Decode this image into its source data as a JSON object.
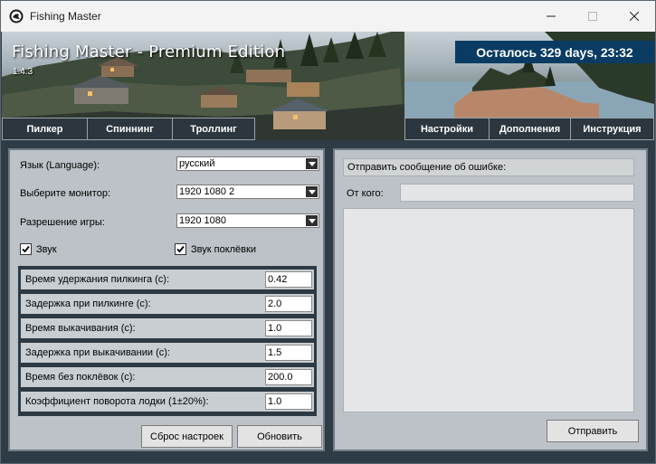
{
  "window": {
    "title": "Fishing Master",
    "icons": {
      "app": "app-logo-icon",
      "minimize": "minimize-icon",
      "maximize": "maximize-icon",
      "close": "close-icon"
    }
  },
  "banner": {
    "title": "Fishing Master - Premium Edition",
    "version": "1.4.3",
    "timer": "Осталось 329 days, 23:32",
    "timer_color": "#0a3c63"
  },
  "tabs_left": [
    {
      "label": "Пилкер"
    },
    {
      "label": "Спиннинг"
    },
    {
      "label": "Троллинг"
    }
  ],
  "tabs_right": [
    {
      "label": "Настройки"
    },
    {
      "label": "Дополнения"
    },
    {
      "label": "Инструкция"
    }
  ],
  "settings": {
    "language_label": "Язык (Language):",
    "language_value": "русский",
    "monitor_label": "Выберите монитор:",
    "monitor_value": "1920 1080 2",
    "resolution_label": "Разрешение игры:",
    "resolution_value": "1920 1080",
    "sound_label": "Звук",
    "sound_checked": true,
    "bite_sound_label": "Звук поклёвки",
    "bite_sound_checked": true,
    "params": [
      {
        "label": "Время удержания пилкинга (с):",
        "value": "0.42"
      },
      {
        "label": "Задержка при пилкинге (с):",
        "value": "2.0"
      },
      {
        "label": "Время выкачивания (с):",
        "value": "1.0"
      },
      {
        "label": "Задержка при выкачивании (с):",
        "value": "1.5"
      },
      {
        "label": "Время без поклёвок (с):",
        "value": "200.0"
      },
      {
        "label": "Коэффициент поворота лодки (1±20%):",
        "value": "1.0"
      }
    ],
    "reset_button": "Сброс настроек",
    "update_button": "Обновить"
  },
  "report": {
    "heading": "Отправить сообщение об ошибке:",
    "from_label": "От кого:",
    "from_value": "",
    "message_value": "",
    "send_button": "Отправить"
  }
}
